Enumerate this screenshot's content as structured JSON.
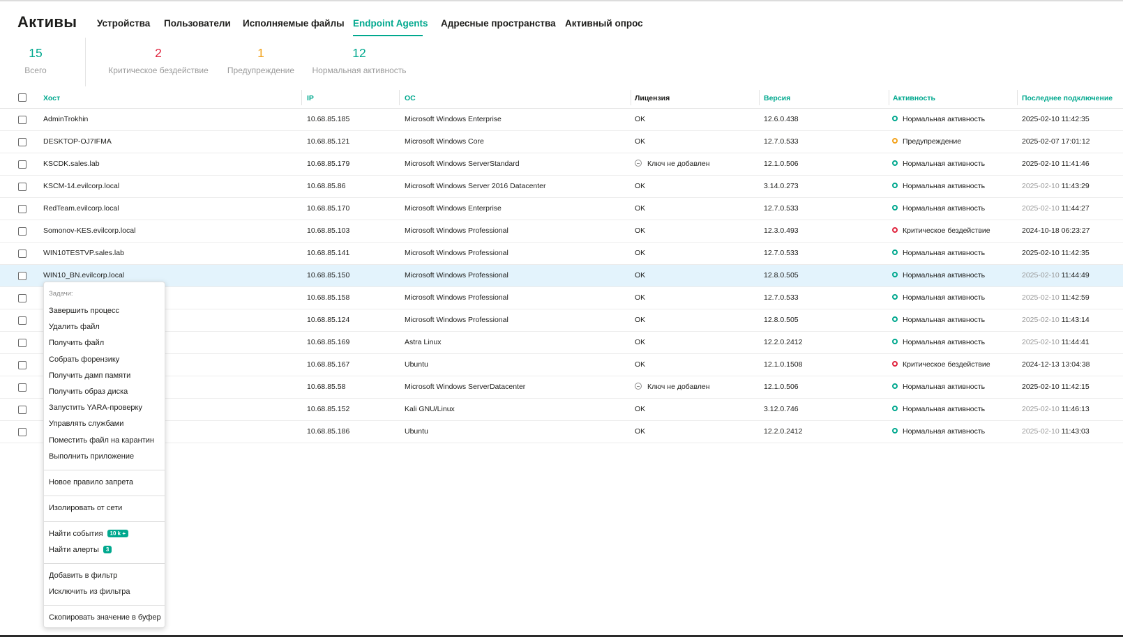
{
  "page": {
    "title": "Активы"
  },
  "tabs": [
    {
      "label": "Устройства",
      "active": false
    },
    {
      "label": "Пользователи",
      "active": false
    },
    {
      "label": "Исполняемые файлы",
      "active": false
    },
    {
      "label": "Endpoint Agents",
      "active": true
    },
    {
      "label": "Адресные пространства",
      "active": false
    },
    {
      "label": "Активный опрос",
      "active": false
    }
  ],
  "stats": {
    "total": {
      "value": "15",
      "label": "Всего"
    },
    "critical": {
      "value": "2",
      "label": "Критическое бездействие"
    },
    "warning": {
      "value": "1",
      "label": "Предупреждение"
    },
    "normal": {
      "value": "12",
      "label": "Нормальная активность"
    }
  },
  "colors": {
    "accent": "#00a88e",
    "critical": "#e0233d",
    "warning": "#f2a21b",
    "selected_row": "#e3f3fc"
  },
  "table": {
    "columns": {
      "host": "Хост",
      "ip": "IP",
      "os": "ОС",
      "license": "Лицензия",
      "version": "Версия",
      "activity": "Активность",
      "last_seen": "Последнее подключение"
    },
    "rows": [
      {
        "host": "AdminTrokhin",
        "ip": "10.68.85.185",
        "os": "Microsoft Windows Enterprise",
        "license": "OK",
        "version": "12.6.0.438",
        "status": "normal",
        "activity": "Нормальная активность",
        "date": "2025-02-10",
        "time": "11:42:35"
      },
      {
        "host": "DESKTOP-OJ7IFMA",
        "ip": "10.68.85.121",
        "os": "Microsoft Windows Core",
        "license": "OK",
        "version": "12.7.0.533",
        "status": "warn",
        "activity": "Предупреждение",
        "date": "2025-02-07",
        "time": "17:01:12"
      },
      {
        "host": "KSCDK.sales.lab",
        "ip": "10.68.85.179",
        "os": "Microsoft Windows ServerStandard",
        "license": "Ключ не добавлен",
        "version": "12.1.0.506",
        "status": "normal",
        "activity": "Нормальная активность",
        "date": "2025-02-10",
        "time": "11:41:46"
      },
      {
        "host": "KSCM-14.evilcorp.local",
        "ip": "10.68.85.86",
        "os": "Microsoft Windows Server 2016 Datacenter",
        "license": "OK",
        "version": "3.14.0.273",
        "status": "normal",
        "activity": "Нормальная активность",
        "date": "2025-02-10",
        "time": "11:43:29"
      },
      {
        "host": "RedTeam.evilcorp.local",
        "ip": "10.68.85.170",
        "os": "Microsoft Windows Enterprise",
        "license": "OK",
        "version": "12.7.0.533",
        "status": "normal",
        "activity": "Нормальная активность",
        "date": "2025-02-10",
        "time": "11:44:27"
      },
      {
        "host": "Somonov-KES.evilcorp.local",
        "ip": "10.68.85.103",
        "os": "Microsoft Windows Professional",
        "license": "OK",
        "version": "12.3.0.493",
        "status": "crit",
        "activity": "Критическое бездействие",
        "date": "2024-10-18",
        "time": "06:23:27"
      },
      {
        "host": "WIN10TESTVP.sales.lab",
        "ip": "10.68.85.141",
        "os": "Microsoft Windows Professional",
        "license": "OK",
        "version": "12.7.0.533",
        "status": "normal",
        "activity": "Нормальная активность",
        "date": "2025-02-10",
        "time": "11:42:35"
      },
      {
        "host": "WIN10_BN.evilcorp.local",
        "ip": "10.68.85.150",
        "os": "Microsoft Windows Professional",
        "license": "OK",
        "version": "12.8.0.505",
        "status": "normal",
        "activity": "Нормальная активность",
        "date": "2025-02-10",
        "time": "11:44:49"
      },
      {
        "host": "",
        "ip": "10.68.85.158",
        "os": "Microsoft Windows Professional",
        "license": "OK",
        "version": "12.7.0.533",
        "status": "normal",
        "activity": "Нормальная активность",
        "date": "2025-02-10",
        "time": "11:42:59"
      },
      {
        "host": "",
        "ip": "10.68.85.124",
        "os": "Microsoft Windows Professional",
        "license": "OK",
        "version": "12.8.0.505",
        "status": "normal",
        "activity": "Нормальная активность",
        "date": "2025-02-10",
        "time": "11:43:14"
      },
      {
        "host": "",
        "ip": "10.68.85.169",
        "os": "Astra Linux",
        "license": "OK",
        "version": "12.2.0.2412",
        "status": "normal",
        "activity": "Нормальная активность",
        "date": "2025-02-10",
        "time": "11:44:41"
      },
      {
        "host": "",
        "ip": "10.68.85.167",
        "os": "Ubuntu",
        "license": "OK",
        "version": "12.1.0.1508",
        "status": "crit",
        "activity": "Критическое бездействие",
        "date": "2024-12-13",
        "time": "13:04:38"
      },
      {
        "host": "",
        "ip": "10.68.85.58",
        "os": "Microsoft Windows ServerDatacenter",
        "license": "Ключ не добавлен",
        "version": "12.1.0.506",
        "status": "normal",
        "activity": "Нормальная активность",
        "date": "2025-02-10",
        "time": "11:42:15"
      },
      {
        "host": "",
        "ip": "10.68.85.152",
        "os": "Kali GNU/Linux",
        "license": "OK",
        "version": "3.12.0.746",
        "status": "normal",
        "activity": "Нормальная активность",
        "date": "2025-02-10",
        "time": "11:46:13"
      },
      {
        "host": "",
        "ip": "10.68.85.186",
        "os": "Ubuntu",
        "license": "OK",
        "version": "12.2.0.2412",
        "status": "normal",
        "activity": "Нормальная активность",
        "date": "2025-02-10",
        "time": "11:43:03"
      }
    ]
  },
  "context_menu": {
    "section_title": "Задачи:",
    "tasks": [
      "Завершить процесс",
      "Удалить файл",
      "Получить файл",
      "Собрать форензику",
      "Получить дамп памяти",
      "Получить образ диска",
      "Запустить YARA-проверку",
      "Управлять службами",
      "Поместить файл на карантин",
      "Выполнить приложение"
    ],
    "new_rule": "Новое правило запрета",
    "isolate": "Изолировать от сети",
    "find_events": "Найти события",
    "find_events_badge": "10 k +",
    "find_alerts": "Найти алерты",
    "find_alerts_badge": "3",
    "add_filter": "Добавить в фильтр",
    "exclude_filter": "Исключить из фильтра",
    "copy_value": "Скопировать значение в буфер"
  }
}
